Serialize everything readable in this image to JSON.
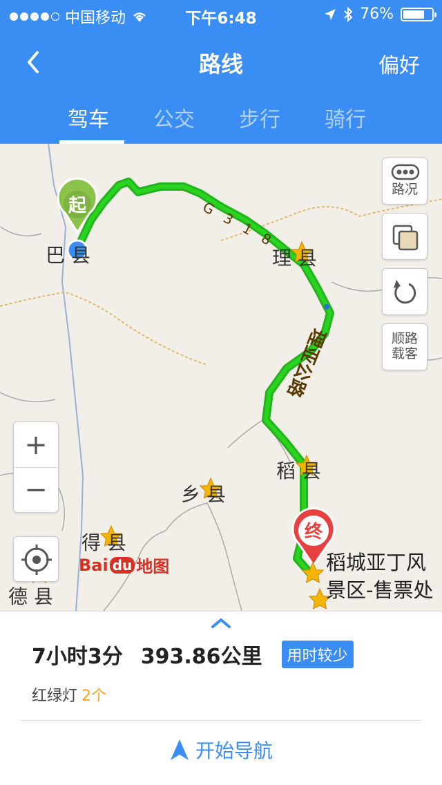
{
  "status_bar": {
    "carrier": "中国移动",
    "time": "下午6:48",
    "battery": "76%",
    "battery_level": 0.76
  },
  "nav": {
    "title": "路线",
    "right": "偏好"
  },
  "tabs": [
    {
      "label": "驾车",
      "active": true
    },
    {
      "label": "公交",
      "active": false
    },
    {
      "label": "步行",
      "active": false
    },
    {
      "label": "骑行",
      "active": false
    }
  ],
  "map": {
    "start_marker": "起",
    "end_marker": "终",
    "road_labels": [
      "G 3 1 8",
      "理亚公路"
    ],
    "places": {
      "batang": "巴  县",
      "litang": "理  县",
      "daocheng": "稻  县",
      "xiangcheng": "乡  县",
      "derong": "得  县",
      "deqin": "德  县"
    },
    "destination": "稻城亚丁风景区-售票处",
    "controls": {
      "traffic": "路况",
      "carpool": "顺路载客",
      "zoom_in": "+",
      "zoom_out": "−"
    },
    "logo": {
      "bai": "Bai",
      "du": "du",
      "map": "地图"
    },
    "route_color": "#22b41c"
  },
  "route": {
    "duration": "7小时3分",
    "distance": "393.86公里",
    "tag": "用时较少",
    "traffic_lights_label": "红绿灯",
    "traffic_lights_count": "2个"
  },
  "action": {
    "start_nav": "开始导航"
  },
  "colors": {
    "brand": "#3a8df3",
    "accent": "#f5a623",
    "end_marker": "#e84040",
    "start_marker": "#8bc34a"
  }
}
